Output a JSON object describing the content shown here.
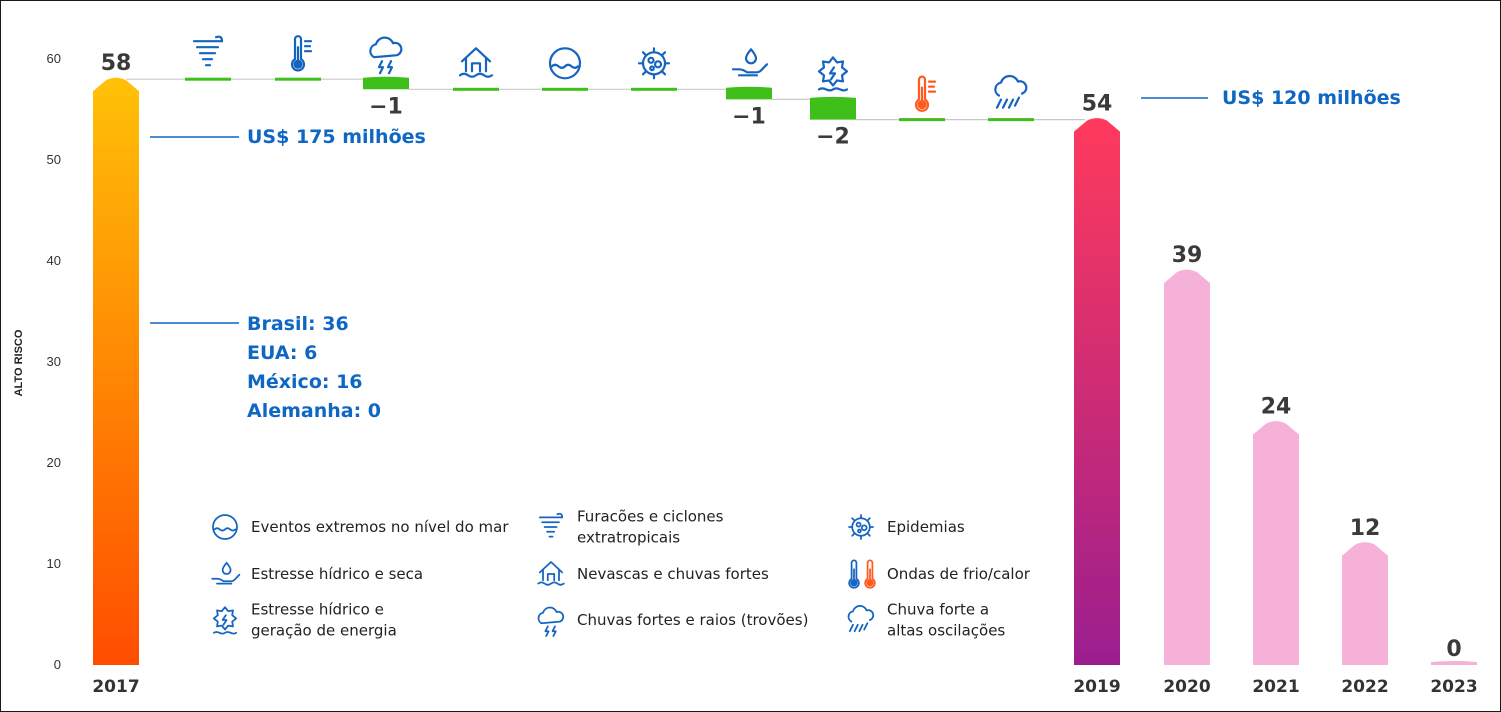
{
  "chart_data": {
    "type": "waterfall-bar",
    "ylabel": "ALTO RISCO",
    "ylim": [
      0,
      60
    ],
    "yticks": [
      0,
      10,
      20,
      30,
      40,
      50,
      60
    ],
    "categories": [
      "2017",
      "2019",
      "2020",
      "2021",
      "2022",
      "2023"
    ],
    "values": [
      58,
      54,
      39,
      24,
      12,
      0
    ],
    "value_labels": [
      "58",
      "54",
      "39",
      "24",
      "12",
      "0"
    ],
    "bar_colors": [
      {
        "top": "#ffc107",
        "bottom": "#ff4d00"
      },
      {
        "top": "#ff3a5c",
        "bottom": "#9b1e8f"
      },
      {
        "top": "#f5b1d8",
        "bottom": "#f5b1d8"
      },
      {
        "top": "#f5b1d8",
        "bottom": "#f5b1d8"
      },
      {
        "top": "#f5b1d8",
        "bottom": "#f5b1d8"
      },
      {
        "top": "#f5b1d8",
        "bottom": "#f5b1d8"
      }
    ],
    "waterfall_steps": [
      {
        "icon": "cyclone-icon",
        "change": 0,
        "label": ""
      },
      {
        "icon": "thermometer-cold-icon",
        "change": 0,
        "label": ""
      },
      {
        "icon": "storm-lightning-icon",
        "change": -1,
        "label": "−1"
      },
      {
        "icon": "flooded-house-icon",
        "change": 0,
        "label": ""
      },
      {
        "icon": "sea-level-icon",
        "change": 0,
        "label": ""
      },
      {
        "icon": "epidemic-virus-icon",
        "change": 0,
        "label": ""
      },
      {
        "icon": "water-stress-hand-icon",
        "change": -1,
        "label": "−1"
      },
      {
        "icon": "water-energy-icon",
        "change": -2,
        "label": "−2"
      },
      {
        "icon": "thermometer-heat-icon",
        "change": 0,
        "label": ""
      },
      {
        "icon": "heavy-rain-icon",
        "change": 0,
        "label": ""
      }
    ],
    "annotations": {
      "cost_2017": "US$ 175 milhões",
      "cost_2019": "US$ 120 milhões",
      "breakdown": [
        "Brasil: 36",
        "EUA: 6",
        "México: 16",
        "Alemanha: 0"
      ]
    },
    "legend": [
      {
        "icon": "sea-level-icon",
        "text": [
          "Eventos extremos no nível do mar"
        ]
      },
      {
        "icon": "water-stress-hand-icon",
        "text": [
          "Estresse hídrico e seca"
        ]
      },
      {
        "icon": "water-energy-icon",
        "text": [
          "Estresse hídrico e",
          "geração de energia"
        ]
      },
      {
        "icon": "cyclone-icon",
        "text": [
          "Furacões e ciclones",
          "extratropicais"
        ]
      },
      {
        "icon": "flooded-house-icon",
        "text": [
          "Nevascas e chuvas fortes"
        ]
      },
      {
        "icon": "storm-lightning-icon",
        "text": [
          "Chuvas fortes e raios (trovões)"
        ]
      },
      {
        "icon": "epidemic-virus-icon",
        "text": [
          "Epidemias"
        ]
      },
      {
        "icon": "cold-heat-waves-icon",
        "text": [
          "Ondas de frio/calor"
        ]
      },
      {
        "icon": "heavy-rain-icon",
        "text": [
          "Chuva forte a",
          "altas oscilações"
        ]
      }
    ],
    "colors": {
      "annotation": "#0f67c4",
      "step": "#3fbf1a",
      "icon": "#1565c0",
      "heat": "#ff5a1f"
    },
    "grid": false,
    "legend_position": "bottom-center"
  }
}
